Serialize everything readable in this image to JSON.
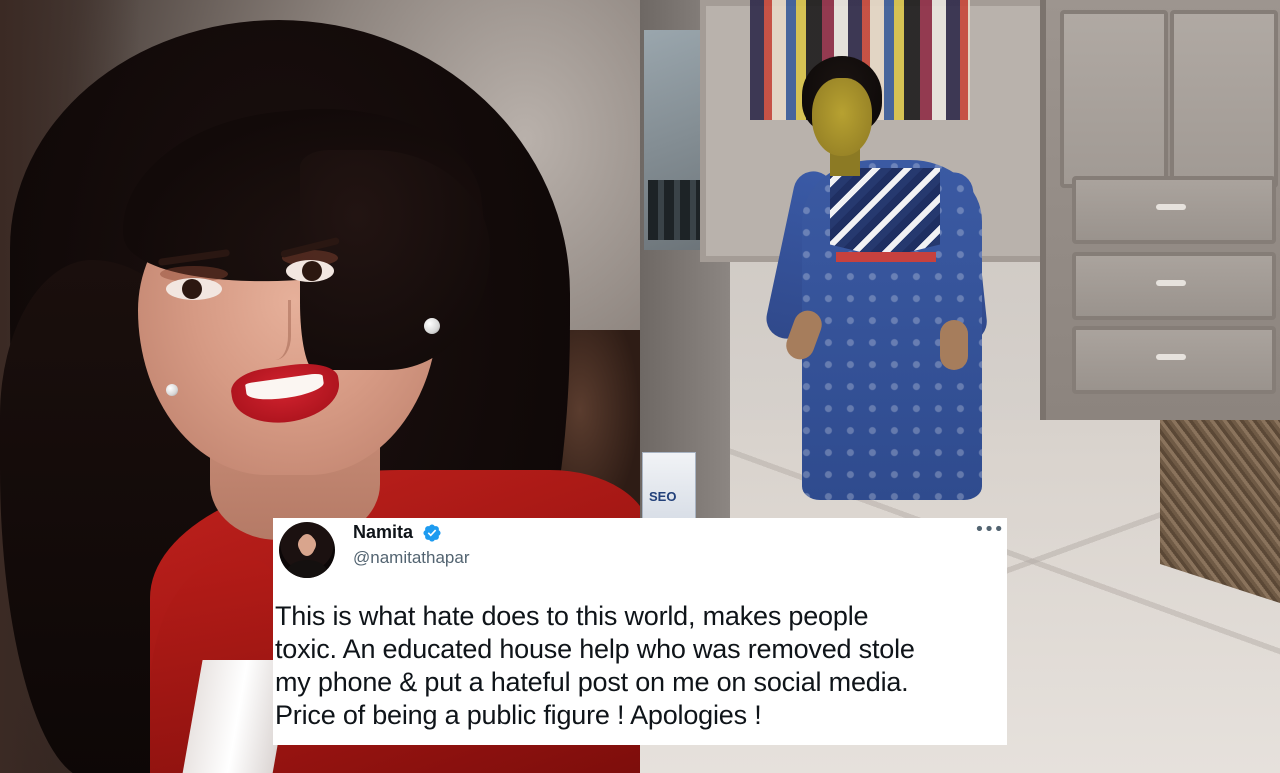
{
  "tweet": {
    "display_name": "Namita",
    "handle": "@namitathapar",
    "verified": true,
    "more_icon": "more-horizontal-icon",
    "text": "This is what hate does to this world, makes people\ntoxic. An educated house help who was removed stole\nmy phone & put a hateful post on me on social media.\nPrice of being a public figure ! Apologies !"
  },
  "photos": {
    "box_label": "SEO"
  },
  "colors": {
    "verified_blue": "#1d9bf0",
    "text_primary": "#0f1419",
    "text_secondary": "#536471",
    "blazer_red": "#c0211d"
  }
}
